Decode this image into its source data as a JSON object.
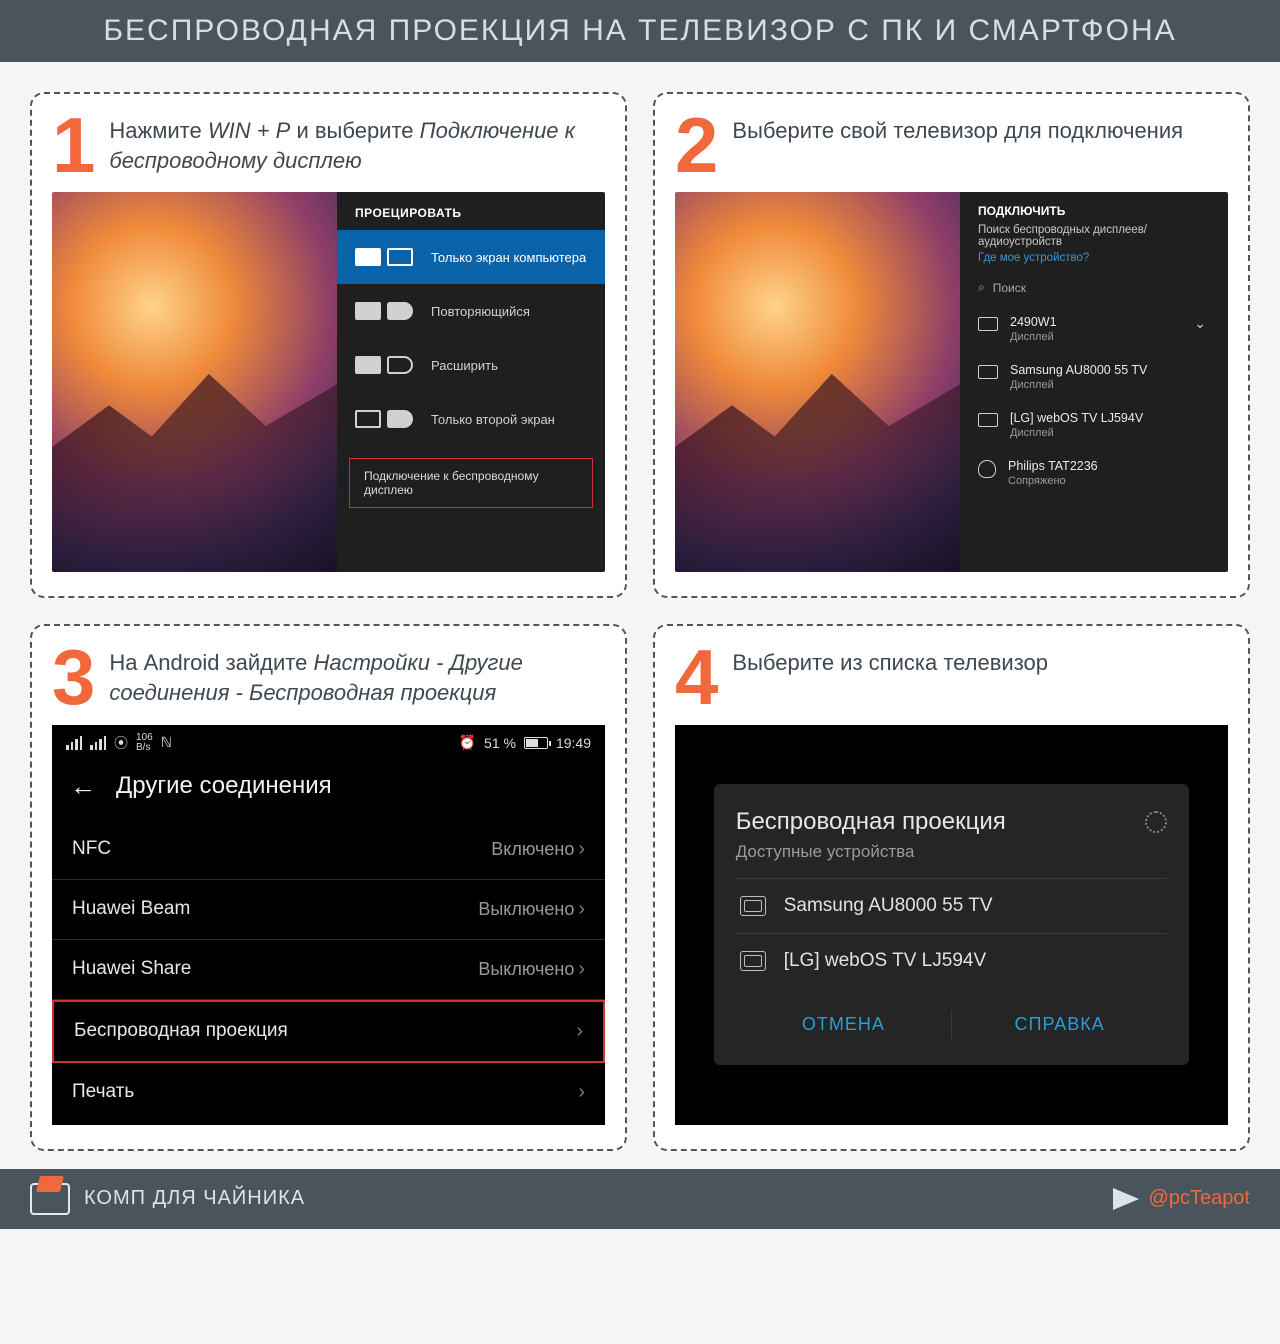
{
  "header": "БЕСПРОВОДНАЯ ПРОЕКЦИЯ НА ТЕЛЕВИЗОР С ПК И СМАРТФОНА",
  "steps": [
    {
      "num": "1",
      "cap_pre": "Нажмите ",
      "cap_em": "WIN + P",
      "cap_mid": " и выберите ",
      "cap_em2": "Подключение к беспроводному дисплею"
    },
    {
      "num": "2",
      "cap_pre": "Выберите свой телевизор для подключения"
    },
    {
      "num": "3",
      "cap_pre": "На Android зайдите ",
      "cap_em": "Настройки - Другие соединения - Беспроводная проекция"
    },
    {
      "num": "4",
      "cap_pre": "Выберите из списка телевизор"
    }
  ],
  "step1": {
    "title": "ПРОЕЦИРОВАТЬ",
    "options": [
      "Только экран компьютера",
      "Повторяющийся",
      "Расширить",
      "Только второй экран"
    ],
    "wireless": "Подключение к беспроводному дисплею"
  },
  "step2": {
    "title": "ПОДКЛЮЧИТЬ",
    "subtitle": "Поиск беспроводных дисплеев/аудиоустройств",
    "link": "Где мое устройство?",
    "search": "Поиск",
    "devices": [
      {
        "name": "2490W1",
        "type": "Дисплей",
        "icon": "display",
        "chev": true
      },
      {
        "name": "Samsung AU8000 55 TV",
        "type": "Дисплей",
        "icon": "display"
      },
      {
        "name": "[LG] webOS TV LJ594V",
        "type": "Дисплей",
        "icon": "display"
      },
      {
        "name": "Philips TAT2236",
        "type": "Сопряжено",
        "icon": "headphones"
      }
    ]
  },
  "step3": {
    "status_rate": "106",
    "status_rate_unit": "B/s",
    "status_nfc": "ℕ",
    "status_alarm": "⏰",
    "status_batt": "51 %",
    "status_time": "19:49",
    "title": "Другие соединения",
    "rows": [
      {
        "label": "NFC",
        "value": "Включено"
      },
      {
        "label": "Huawei Beam",
        "value": "Выключено"
      },
      {
        "label": "Huawei Share",
        "value": "Выключено"
      },
      {
        "label": "Беспроводная проекция",
        "value": "",
        "hl": true
      },
      {
        "label": "Печать",
        "value": ""
      }
    ]
  },
  "step4": {
    "title": "Беспроводная проекция",
    "subtitle": "Доступные устройства",
    "devices": [
      "Samsung AU8000 55 TV",
      "[LG] webOS TV LJ594V"
    ],
    "btn_cancel": "ОТМЕНА",
    "btn_help": "СПРАВКА"
  },
  "footer": {
    "brand": "КОМП ДЛЯ ЧАЙНИКА",
    "telegram": "@pcTeapot"
  }
}
